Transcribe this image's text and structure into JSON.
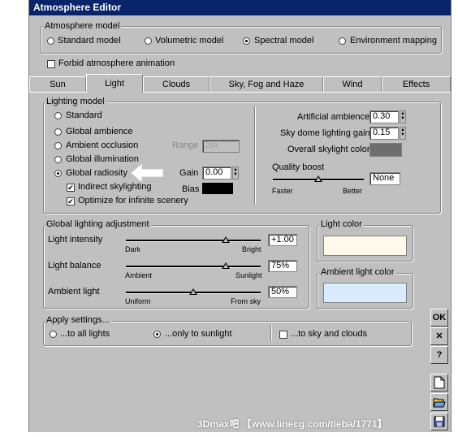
{
  "window": {
    "title": "Atmosphere Editor"
  },
  "atmosphere_model": {
    "legend": "Atmosphere model",
    "options": [
      "Standard model",
      "Volumetric model",
      "Spectral model",
      "Environment mapping"
    ],
    "selected": "Spectral model"
  },
  "forbid_animation": {
    "label": "Forbid atmosphere animation",
    "checked": false
  },
  "tabs": [
    "Sun",
    "Light",
    "Clouds",
    "Sky, Fog and Haze",
    "Wind",
    "Effects"
  ],
  "active_tab": "Light",
  "lighting_model": {
    "legend": "Lighting model",
    "options": [
      "Standard",
      "Global ambience",
      "Ambient occlusion",
      "Global illumination",
      "Global radiosity"
    ],
    "selected": "Global radiosity",
    "range_label": "Range",
    "range_value": "2m",
    "gain_label": "Gain",
    "gain_value": "0.00",
    "bias_label": "Bias",
    "bias_color": "#000000",
    "indirect_skylighting": {
      "label": "Indirect skylighting",
      "checked": true
    },
    "optimize_infinite": {
      "label": "Optimize for infinite scenery",
      "checked": true
    },
    "artificial_ambience_label": "Artificial ambience",
    "artificial_ambience_value": "0.30",
    "sky_dome_gain_label": "Sky dome lighting gain",
    "sky_dome_gain_value": "0.15",
    "overall_skylight_label": "Overall skylight color",
    "overall_skylight_color": "#6e6e6e",
    "quality_boost_label": "Quality boost",
    "quality_boost_value": "None",
    "quality_min_label": "Faster",
    "quality_max_label": "Better",
    "quality_level": 0.5
  },
  "global_adjustment": {
    "legend": "Global lighting adjustment",
    "rows": [
      {
        "label": "Light intensity",
        "min": "Dark",
        "max": "Bright",
        "value": "+1.00",
        "level": 0.8
      },
      {
        "label": "Light balance",
        "min": "Ambient",
        "max": "Sunlight",
        "value": "75%",
        "level": 0.75
      },
      {
        "label": "Ambient light",
        "min": "Uniform",
        "max": "From sky",
        "value": "50%",
        "level": 0.5
      }
    ]
  },
  "light_color": {
    "legend": "Light color",
    "color": "#fff9ea"
  },
  "ambient_light_color": {
    "legend": "Ambient light color",
    "color": "#d8ebff"
  },
  "apply_settings": {
    "legend": "Apply settings...",
    "options": [
      "...to all lights",
      "...only to sunlight"
    ],
    "selected": "...only to sunlight",
    "sky_clouds": {
      "label": "...to sky and clouds",
      "checked": false
    }
  },
  "side_buttons": {
    "ok": "OK",
    "cancel": "✕",
    "help": "?"
  },
  "watermark": "3Dmax吧 【www.linecg.com/tieba/1771】"
}
